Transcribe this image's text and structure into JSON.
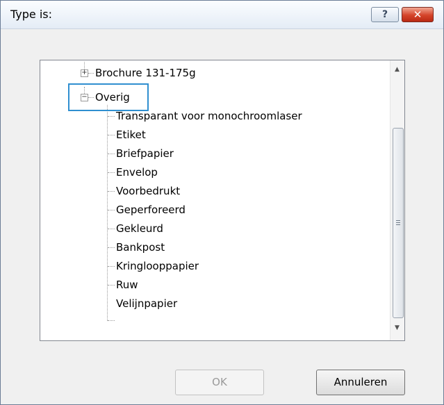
{
  "window": {
    "title": "Type is:",
    "help_label": "?",
    "close_label": "✕"
  },
  "tree": {
    "collapsed_group": "Brochure 131-175g",
    "expanded_group": "Overig",
    "children": [
      "Transparant voor monochroomlaser",
      "Etiket",
      "Briefpapier",
      "Envelop",
      "Voorbedrukt",
      "Geperforeerd",
      "Gekleurd",
      "Bankpost",
      "Kringlooppapier",
      "Ruw",
      "Velijnpapier"
    ],
    "expander_plus": "+",
    "expander_minus": "−"
  },
  "scrollbar": {
    "up_arrow": "▲",
    "down_arrow": "▼"
  },
  "buttons": {
    "ok_label": "OK",
    "cancel_label": "Annuleren"
  }
}
